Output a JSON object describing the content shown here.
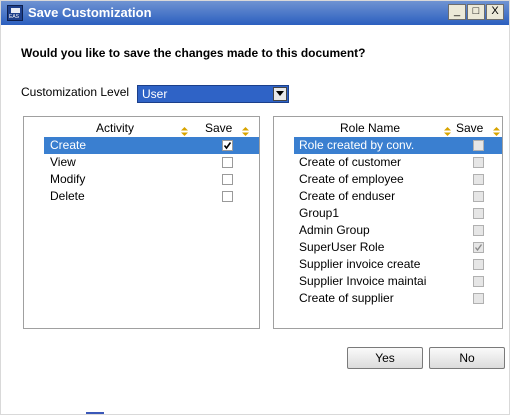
{
  "window": {
    "title": "Save Customization",
    "app_badge": "EAS",
    "controls": {
      "minimize": "_",
      "maximize": "□",
      "close": "X"
    }
  },
  "prompt": "Would you like to save the changes made to this document?",
  "customization": {
    "label": "Customization Level",
    "value": "User"
  },
  "activity_table": {
    "columns": [
      "Activity",
      "Save"
    ],
    "rows": [
      {
        "name": "Create",
        "checked": true,
        "selected": true
      },
      {
        "name": "View",
        "checked": false
      },
      {
        "name": "Modify",
        "checked": false
      },
      {
        "name": "Delete",
        "checked": false
      }
    ]
  },
  "role_table": {
    "columns": [
      "Role Name",
      "Save"
    ],
    "rows": [
      {
        "name": "Role created by conv.",
        "checked": false,
        "selected": true
      },
      {
        "name": "Create of customer",
        "checked": false
      },
      {
        "name": "Create of employee",
        "checked": false
      },
      {
        "name": "Create of enduser",
        "checked": false
      },
      {
        "name": "Group1",
        "checked": false
      },
      {
        "name": "Admin Group",
        "checked": false
      },
      {
        "name": "SuperUser Role",
        "checked": true
      },
      {
        "name": "Supplier invoice create",
        "checked": false
      },
      {
        "name": "Supplier Invoice maintai",
        "checked": false
      },
      {
        "name": "Create of supplier",
        "checked": false
      }
    ]
  },
  "buttons": {
    "yes": "Yes",
    "no": "No"
  },
  "colors": {
    "selection": "#3a7fd0",
    "title_bar": "#2b5fbf",
    "combo": "#2f63c6",
    "sort_icon": "#d8a400"
  }
}
